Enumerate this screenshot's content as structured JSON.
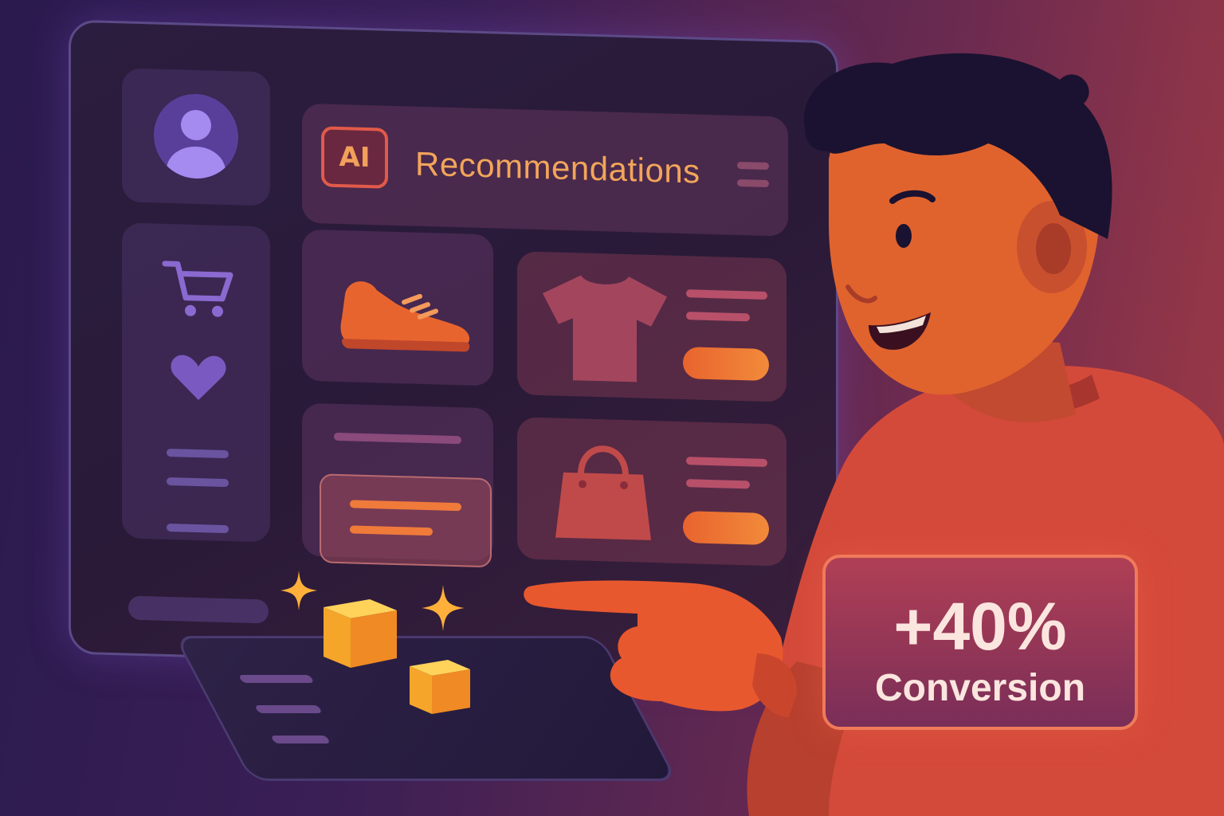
{
  "header": {
    "badge": "AI",
    "title": "Recommendations"
  },
  "stat": {
    "value": "+40%",
    "label": "Conversion"
  },
  "icons": {
    "profile": "user-avatar-icon",
    "nav": [
      "cart-icon",
      "heart-icon"
    ],
    "products": [
      "sneaker-icon",
      "t-shirt-icon",
      "handbag-icon"
    ]
  },
  "colors": {
    "accent": "#f2a55a",
    "button": "#e8642e",
    "nav_icons": "#8a6ad0",
    "stat_border": "#f07a5a"
  }
}
